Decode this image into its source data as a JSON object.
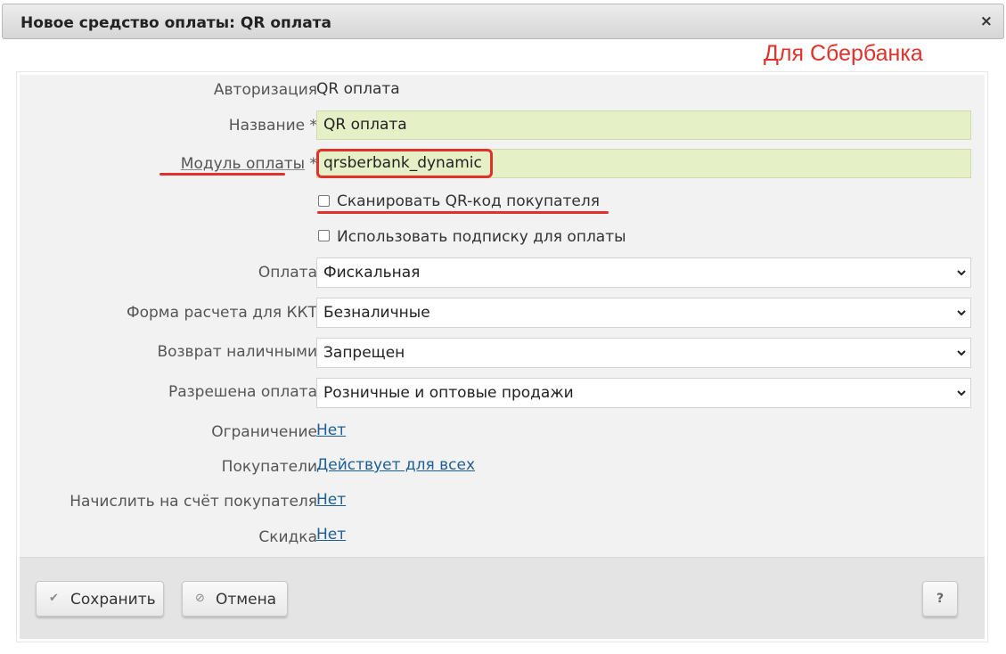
{
  "dialog": {
    "title": "Новое средство оплаты: QR оплата",
    "close_symbol": "×",
    "annotation": "Для Сбербанка"
  },
  "form": {
    "authorization": {
      "label": "Авторизация",
      "value": "QR оплата"
    },
    "name": {
      "label": "Название *",
      "value": "QR оплата"
    },
    "module": {
      "label": "Модуль оплаты",
      "required_mark": "*",
      "value": "qrsberbank_dynamic"
    },
    "scan_qr": {
      "label": "Сканировать QR-код покупателя",
      "checked": false
    },
    "use_subscription": {
      "label": "Использовать подписку для оплаты",
      "checked": false
    },
    "payment": {
      "label": "Оплата",
      "value": "Фискальная"
    },
    "kkt_form": {
      "label": "Форма расчета для ККТ",
      "value": "Безналичные"
    },
    "cash_return": {
      "label": "Возврат наличными",
      "value": "Запрещен"
    },
    "allowed_payment": {
      "label": "Разрешена оплата",
      "value": "Розничные и оптовые продажи"
    },
    "limitation": {
      "label": "Ограничение",
      "value": "Нет"
    },
    "customers": {
      "label": "Покупатели",
      "value": "Действует для всех"
    },
    "credit_account": {
      "label": "Начислить на счёт покупателя",
      "value": "Нет"
    },
    "discount": {
      "label": "Скидка",
      "value": "Нет"
    }
  },
  "footer": {
    "save_label": "Сохранить",
    "save_icon": "✔",
    "cancel_label": "Отмена",
    "cancel_icon": "⊘",
    "help_label": "?"
  },
  "colors": {
    "accent_red": "#e0312a",
    "input_green": "#e6f0c7",
    "link_blue": "#1d5e95"
  }
}
